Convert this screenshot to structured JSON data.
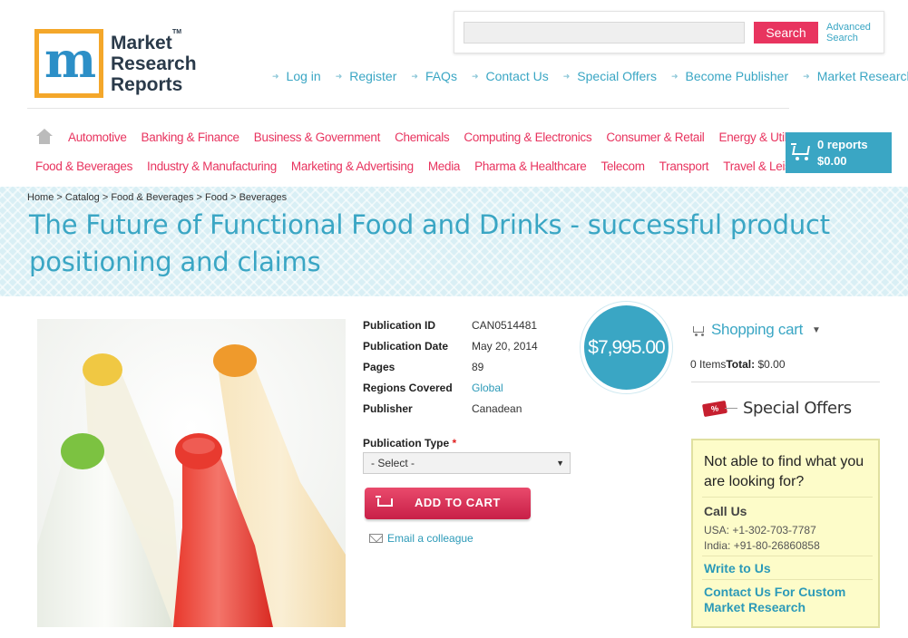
{
  "brand": {
    "logo_letter": "m",
    "logo_lines": [
      "Market",
      "Research",
      "Reports"
    ],
    "tm": "TM"
  },
  "search": {
    "placeholder": "",
    "button": "Search",
    "advanced_line1": "Advanced",
    "advanced_line2": "Search"
  },
  "topnav": [
    "Log in",
    "Register",
    "FAQs",
    "Contact Us",
    "Special Offers",
    "Become Publisher",
    "Market Research Blog"
  ],
  "categories_row1": [
    "Automotive",
    "Banking & Finance",
    "Business & Government",
    "Chemicals",
    "Computing & Electronics",
    "Consumer & Retail",
    "Energy & Utilities"
  ],
  "categories_row2": [
    "Food & Beverages",
    "Industry & Manufacturing",
    "Marketing & Advertising",
    "Media",
    "Pharma & Healthcare",
    "Telecom",
    "Transport",
    "Travel & Leisure"
  ],
  "cart_widget": {
    "count": "0 reports",
    "total": "$0.00"
  },
  "breadcrumb": "Home > Catalog > Food & Beverages > Food > Beverages",
  "title": "The Future of Functional Food and Drinks - successful product positioning and claims",
  "details": {
    "pub_id_label": "Publication ID",
    "pub_id": "CAN0514481",
    "date_label": "Publication Date",
    "date": "May 20, 2014",
    "pages_label": "Pages",
    "pages": "89",
    "regions_label": "Regions Covered",
    "regions": "Global",
    "publisher_label": "Publisher",
    "publisher": "Canadean"
  },
  "price": "$7,995.00",
  "publication_type": {
    "label": "Publication Type",
    "required": "*",
    "selected": "- Select -"
  },
  "add_to_cart": "ADD TO CART",
  "email_colleague": "Email a colleague",
  "shopping_cart": {
    "title": "Shopping cart",
    "items": "0 Items",
    "total_label": "Total:",
    "total": " $0.00"
  },
  "special_offers": {
    "tag": "%",
    "label": "Special Offers"
  },
  "help": {
    "question": "Not able to find what you are looking for?",
    "call_us": "Call Us",
    "usa": "USA: +1-302-703-7787",
    "india": "India: +91-80-26860858",
    "write": "Write to Us",
    "custom": "Contact Us For Custom Market Research"
  },
  "colors": {
    "accent": "#3aa6c4",
    "brand_pink": "#e8345f",
    "logo_orange": "#f4a72a"
  }
}
